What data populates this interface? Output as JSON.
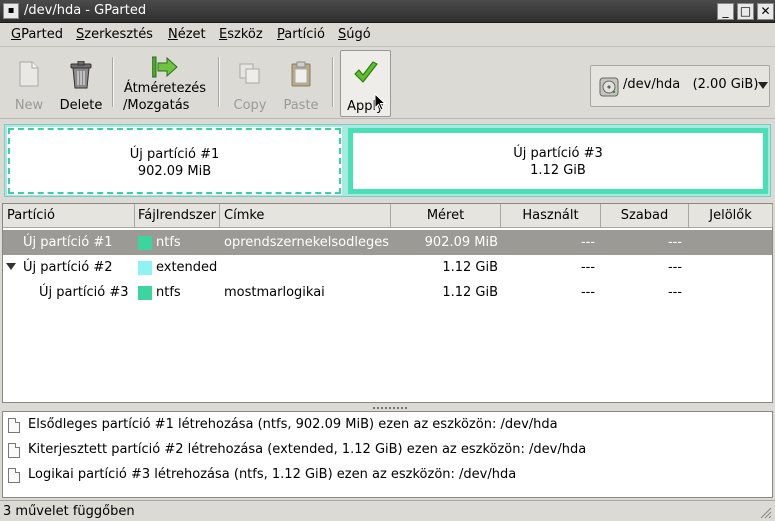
{
  "window": {
    "title": "/dev/hda - GParted",
    "menu_button_glyph": "▪",
    "minimize_glyph": "_",
    "maximize_glyph": "□",
    "close_glyph": "✕"
  },
  "menubar": [
    {
      "label": "GParted",
      "mnemonic": "G",
      "rest": "Parted"
    },
    {
      "label": "Szerkesztés",
      "mnemonic": "S",
      "rest": "zerkesztés"
    },
    {
      "label": "Nézet",
      "mnemonic": "N",
      "rest": "ézet"
    },
    {
      "label": "Eszköz",
      "mnemonic": "E",
      "rest": "szköz"
    },
    {
      "label": "Partíció",
      "mnemonic": "P",
      "rest": "artíció"
    },
    {
      "label": "Súgó",
      "mnemonic": "S",
      "rest": "úgó"
    }
  ],
  "toolbar": {
    "new_label": "New",
    "delete_label": "Delete",
    "resize_line1": "Átméretezés",
    "resize_line2": "/Mozgatás",
    "copy_label": "Copy",
    "paste_label": "Paste",
    "apply_label": "Apply",
    "new_icon": "document-icon",
    "delete_icon": "trash-icon",
    "resize_icon": "resize-arrow-icon",
    "copy_icon": "copy-icon",
    "paste_icon": "paste-icon",
    "apply_icon": "checkmark-icon"
  },
  "device": {
    "name": "/dev/hda",
    "size": "(2.00 GiB)",
    "icon": "harddisk-icon"
  },
  "diskmap": {
    "p1_name": "Új partíció #1",
    "p1_size": "902.09 MiB",
    "p3_name": "Új partíció #3",
    "p3_size": "1.12 GiB"
  },
  "columns": {
    "partition": "Partíció",
    "filesystem": "Fájlrendszer",
    "label": "Címke",
    "size": "Méret",
    "used": "Használt",
    "free": "Szabad",
    "flags": "Jelölők"
  },
  "rows": [
    {
      "partition": "Új partíció #1",
      "filesystem": "ntfs",
      "fs_color": "#3cd5a0",
      "label": "oprendszernekelsodleges",
      "size": "902.09 MiB",
      "used": "---",
      "free": "---",
      "flags": ""
    },
    {
      "partition": "Új partíció #2",
      "filesystem": "extended",
      "fs_color": "#8ef3f2",
      "label": "",
      "size": "1.12 GiB",
      "used": "---",
      "free": "---",
      "flags": ""
    },
    {
      "partition": "Új partíció #3",
      "filesystem": "ntfs",
      "fs_color": "#3cd5a0",
      "label": "mostmarlogikai",
      "size": "1.12 GiB",
      "used": "---",
      "free": "---",
      "flags": ""
    }
  ],
  "operations": [
    "Elsődleges partíció #1 létrehozása (ntfs, 902.09 MiB) ezen az eszközön: /dev/hda",
    "Kiterjesztett partíció #2 létrehozása (extended, 1.12 GiB) ezen az eszközön: /dev/hda",
    "Logikai partíció #3 létrehozása (ntfs, 1.12 GiB) ezen az eszközön: /dev/hda"
  ],
  "status": "3 művelet függőben",
  "colors": {
    "ntfs": "#3cd5a0",
    "extended": "#8ef3f2",
    "selection": "#9c9a95"
  }
}
